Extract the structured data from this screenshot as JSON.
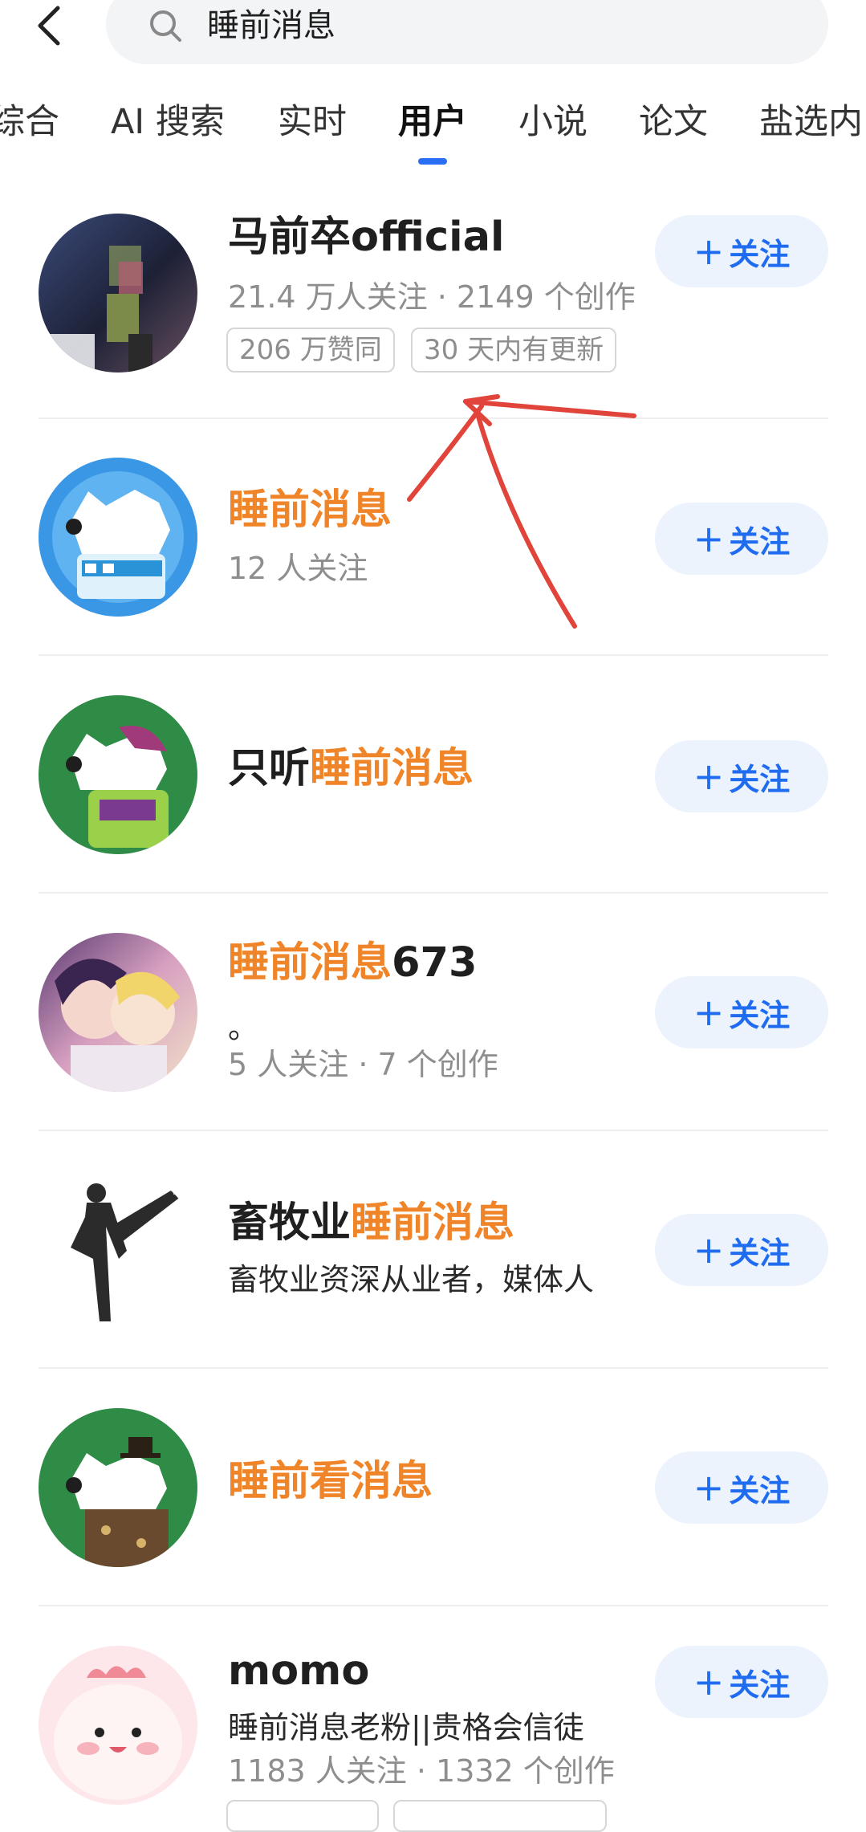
{
  "search": {
    "query": "睡前消息"
  },
  "tabs": [
    "综合",
    "AI 搜索",
    "实时",
    "用户",
    "小说",
    "论文",
    "盐选内"
  ],
  "active_tab": "用户",
  "follow_label": "关注",
  "users": [
    {
      "name": "马前卒official",
      "meta": "21.4 万人关注 · 2149 个创作",
      "badges": [
        "206 万赞同",
        "30 天内有更新"
      ]
    },
    {
      "name_highlight": "睡前消息",
      "meta": "12 人关注"
    },
    {
      "name_prefix": "只听",
      "name_highlight": "睡前消息"
    },
    {
      "name_highlight": "睡前消息",
      "name_suffix": "673",
      "desc": "。",
      "meta": "5 人关注 · 7 个创作"
    },
    {
      "name_prefix": "畜牧业",
      "name_highlight": "睡前消息",
      "desc": "畜牧业资深从业者，媒体人"
    },
    {
      "name_highlight": "睡前看消息"
    },
    {
      "name": "momo",
      "desc": "睡前消息老粉||贵格会信徒",
      "meta": "1183 人关注 · 1332 个创作"
    }
  ],
  "colors": {
    "highlight": "#f08428",
    "accent": "#1f6cf0",
    "annotation": "#e0443a"
  }
}
